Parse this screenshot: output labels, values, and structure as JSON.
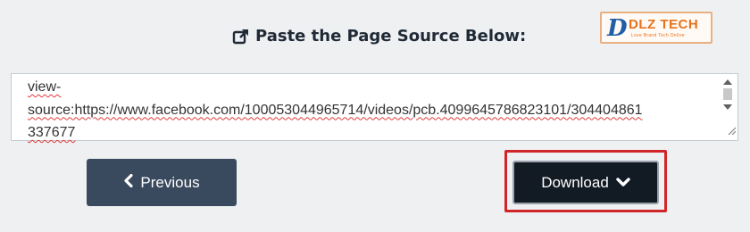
{
  "header": {
    "title": "Paste the Page Source Below:",
    "title_icon": "external-link-icon"
  },
  "logo": {
    "mark": "D",
    "text": "DLZ TECH",
    "tagline": "Love Brand Tech Online"
  },
  "source_box": {
    "lines": [
      "view-",
      "source:https://www.facebook.com/100053044965714/videos/pcb.4099645786823101/304404861",
      "337677"
    ]
  },
  "buttons": {
    "previous_label": "Previous",
    "previous_icon": "chevron-left-icon",
    "download_label": "Download",
    "download_icon": "chevron-down-icon"
  },
  "colors": {
    "highlight": "#d0262a",
    "logo_blue": "#1f5fa8",
    "logo_orange": "#e8721b"
  }
}
